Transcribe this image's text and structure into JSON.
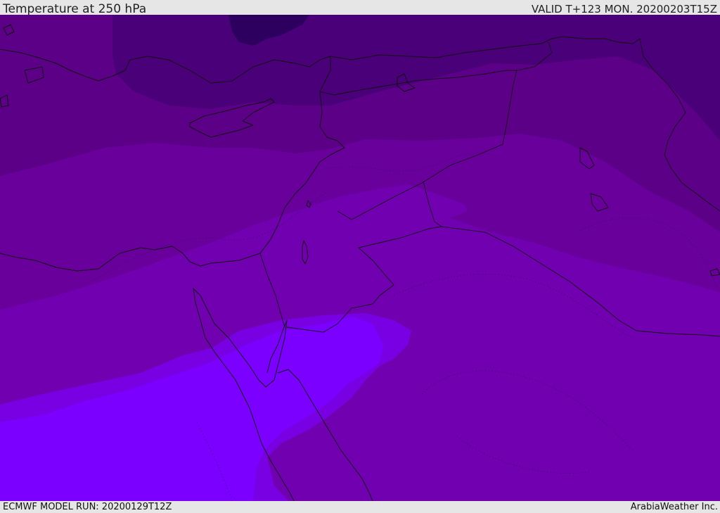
{
  "header": {
    "title": "Temperature at 250 hPa",
    "valid": "VALID T+123 MON. 20200203T15Z"
  },
  "footer": {
    "model_run": "ECMWF MODEL RUN: 20200129T12Z",
    "credit": "ArabiaWeather Inc."
  },
  "map": {
    "field": "temperature_250hPa",
    "fill_colors": [
      "#2d0060",
      "#4a0078",
      "#5c0088",
      "#6a009c",
      "#7000b0",
      "#7500cc",
      "#7800e2",
      "#7c00ff"
    ],
    "layers": [
      "temperature-contour-fill",
      "coastlines",
      "country-borders",
      "dotted-isolines"
    ]
  }
}
